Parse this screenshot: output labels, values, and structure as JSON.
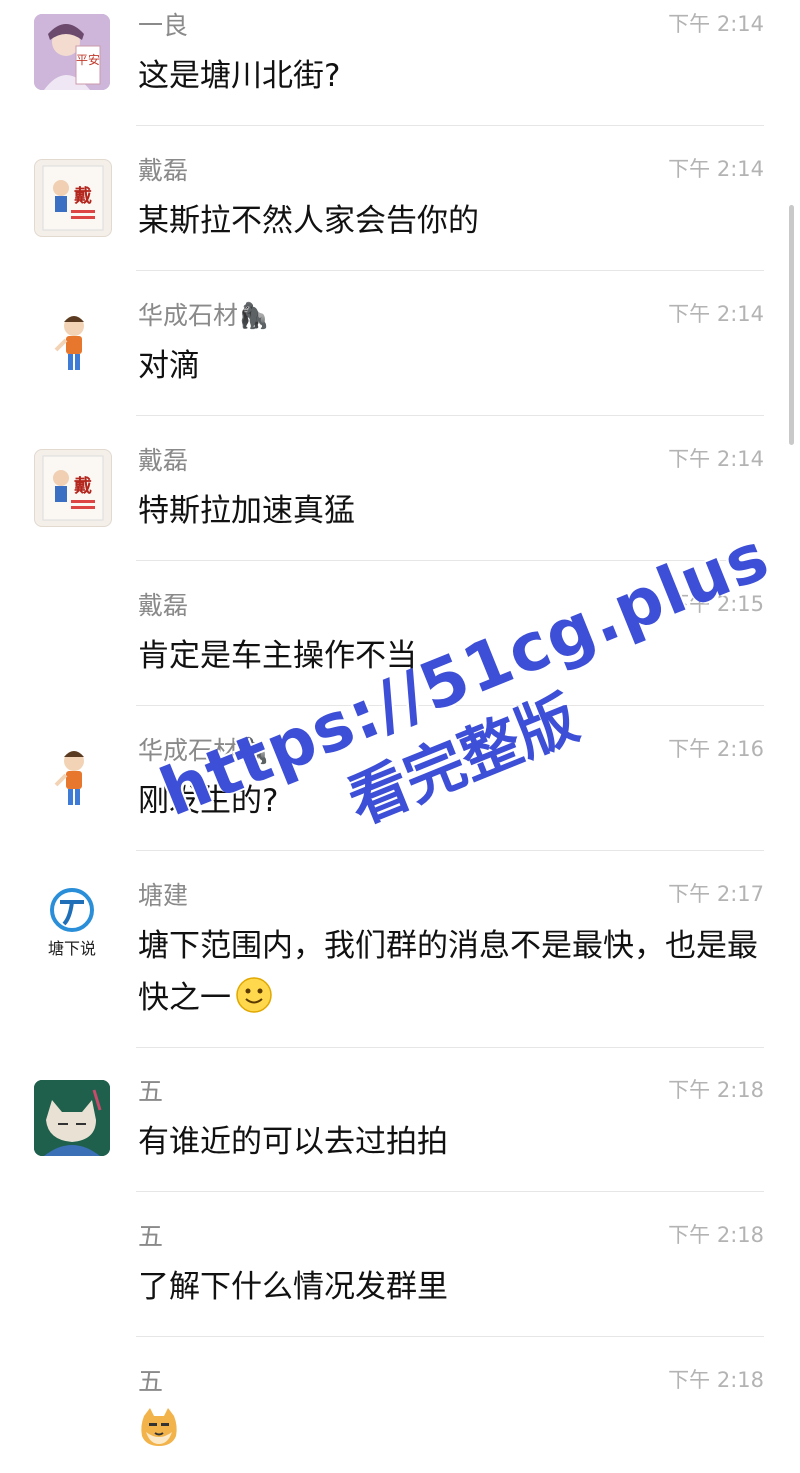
{
  "messages": [
    {
      "name": "一良",
      "time": "下午 2:14",
      "text": "这是塘川北街?",
      "avatar": "avatar-photo-ping-an"
    },
    {
      "name": "戴磊",
      "time": "下午 2:14",
      "text": "某斯拉不然人家会告你的",
      "avatar": "avatar-card-dai",
      "avatar_glyph": "戴"
    },
    {
      "name": "华成石材🦍",
      "time": "下午 2:14",
      "text": "对滴",
      "avatar": "avatar-cartoon-kid"
    },
    {
      "name": "戴磊",
      "time": "下午 2:14",
      "text": "特斯拉加速真猛",
      "avatar": "avatar-card-dai",
      "avatar_glyph": "戴"
    },
    {
      "name": "戴磊",
      "time": "下午 2:15",
      "text": "肯定是车主操作不当",
      "avatar": "none"
    },
    {
      "name": "华成石材🦍",
      "time": "下午 2:16",
      "text": "刚发生的?",
      "avatar": "avatar-cartoon-kid"
    },
    {
      "name": "塘建",
      "time": "下午 2:17",
      "text": "塘下范围内，我们群的消息不是最快，也是最快之一",
      "avatar": "avatar-logo-tangxiashuo",
      "avatar_caption": "塘下说",
      "emoji": "smile-emoji"
    },
    {
      "name": "五",
      "time": "下午 2:18",
      "text": "有谁近的可以去过拍拍",
      "avatar": "avatar-illustration-cat"
    },
    {
      "name": "五",
      "time": "下午 2:18",
      "text": "了解下什么情况发群里",
      "avatar": "none"
    },
    {
      "name": "五",
      "time": "下午 2:18",
      "text": "",
      "avatar": "none",
      "emoji": "doge-emoji"
    }
  ],
  "avatar_labels": {
    "ping_an": "平安"
  },
  "watermark": {
    "line1": "https://51cg.plus",
    "line2": "看完整版"
  },
  "colors": {
    "name": "#8a8a8a",
    "time": "#b3b3b3",
    "text": "#111111",
    "divider": "#e6e6e6",
    "watermark": "#3d4fd6"
  }
}
